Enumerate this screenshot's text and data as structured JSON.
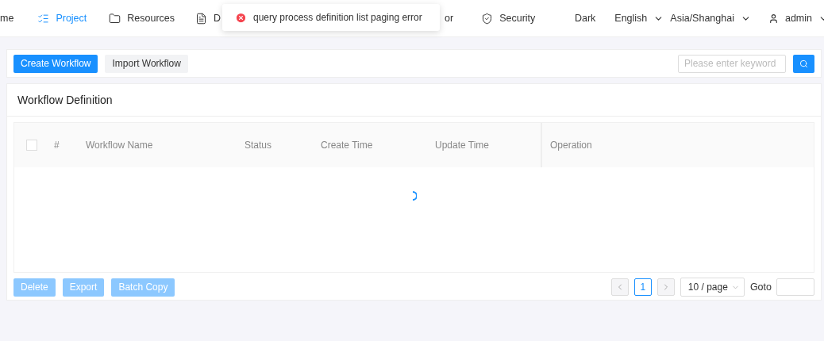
{
  "nav": {
    "items": [
      {
        "label": "me",
        "selected": false
      },
      {
        "label": "Project",
        "selected": true
      },
      {
        "label": "Resources",
        "selected": false
      },
      {
        "label": "D",
        "selected": false
      },
      {
        "label": "or",
        "selected": false
      },
      {
        "label": "Security",
        "selected": false
      }
    ],
    "theme": "Dark",
    "language": "English",
    "timezone": "Asia/Shanghai",
    "user": "admin"
  },
  "toast": {
    "kind": "error",
    "message": "query process definition list paging error"
  },
  "toolbar": {
    "create": "Create Workflow",
    "import": "Import Workflow",
    "search_placeholder": "Please enter keyword"
  },
  "card": {
    "title": "Workflow Definition",
    "table": {
      "checked": false,
      "columns": [
        "#",
        "Workflow Name",
        "Status",
        "Create Time",
        "Update Time",
        "Operation"
      ],
      "loading": true
    },
    "actions": [
      {
        "label": "Delete",
        "disabled": true
      },
      {
        "label": "Export",
        "disabled": true
      },
      {
        "label": "Batch Copy",
        "disabled": true
      }
    ],
    "pagination": {
      "pages": [
        {
          "label": "1",
          "selected": true
        }
      ],
      "page_size": "10 / page",
      "goto": "Goto"
    }
  }
}
